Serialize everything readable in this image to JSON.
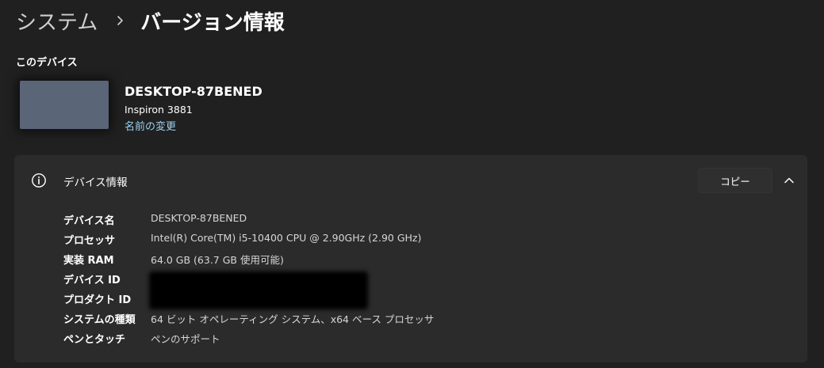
{
  "breadcrumb": {
    "parent": "システム",
    "current": "バージョン情報"
  },
  "this_device": {
    "section_label": "このデバイス",
    "device_name": "DESKTOP-87BENED",
    "model": "Inspiron 3881",
    "rename_link": "名前の変更"
  },
  "device_info": {
    "title": "デバイス情報",
    "copy_button": "コピー",
    "specs": [
      {
        "label": "デバイス名",
        "value": "DESKTOP-87BENED"
      },
      {
        "label": "プロセッサ",
        "value": "Intel(R) Core(TM) i5-10400 CPU @ 2.90GHz (2.90 GHz)"
      },
      {
        "label": "実装 RAM",
        "value": "64.0 GB (63.7 GB 使用可能)"
      },
      {
        "label": "デバイス ID",
        "value": ""
      },
      {
        "label": "プロダクト ID",
        "value": ""
      },
      {
        "label": "システムの種類",
        "value": "64 ビット オペレーティング システム、x64 ベース プロセッサ"
      },
      {
        "label": "ペンとタッチ",
        "value": "ペンのサポート"
      }
    ]
  },
  "colors": {
    "background": "#202020",
    "card": "#2b2b2b",
    "link": "#9bd0f0",
    "thumbnail": "#5a6577"
  }
}
